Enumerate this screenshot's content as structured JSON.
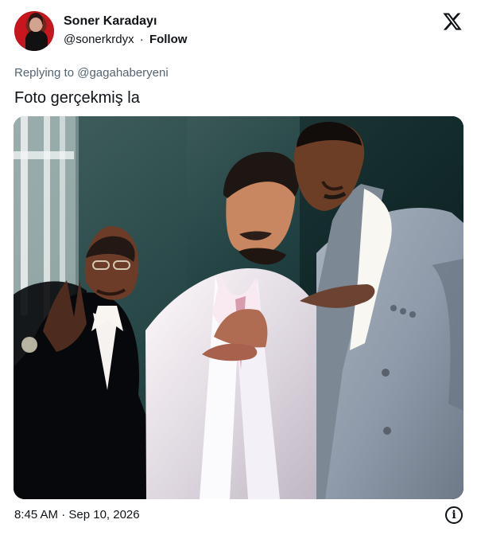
{
  "tweet": {
    "display_name": "Soner Karadayı",
    "handle": "@sonerkrdyx",
    "separator": "·",
    "follow_label": "Follow",
    "reply_prefix": "Replying to",
    "reply_handle": "@gagahaberyeni",
    "text": "Foto gerçekmiş la",
    "timestamp": "8:45 AM · Sep 10, 2026"
  },
  "icons": {
    "platform_logo": "x-logo-icon",
    "info": "info-icon",
    "info_glyph": "i"
  },
  "media": {
    "alt": "photo of three men standing together"
  },
  "colors": {
    "text_primary": "#0f1419",
    "text_secondary": "#536471",
    "background": "#ffffff"
  }
}
